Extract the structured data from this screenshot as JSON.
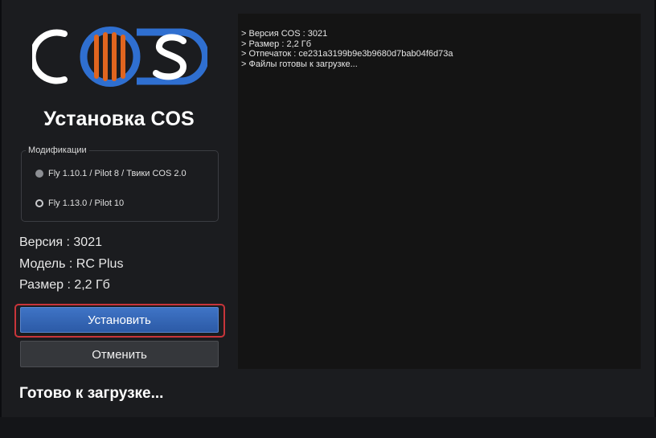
{
  "brand": {
    "logo_text": "COS",
    "colors": {
      "white": "#ffffff",
      "blue": "#2f6fd0",
      "orange": "#e0651f"
    }
  },
  "app_title": "Установка COS",
  "modifications": {
    "legend": "Модификации",
    "options": [
      {
        "label": "Fly 1.10.1 / Pilot 8 / Твики COS 2.0",
        "selected": false
      },
      {
        "label": "Fly 1.13.0 / Pilot 10",
        "selected": true
      }
    ]
  },
  "info": {
    "version": "Версия : 3021",
    "model": "Модель : RC Plus",
    "size": "Размер : 2,2 Гб"
  },
  "buttons": {
    "install": "Установить",
    "cancel": "Отменить"
  },
  "status": "Готово к загрузке...",
  "log": {
    "lines": [
      "> Версия COS : 3021",
      "> Размер : 2,2 Гб",
      "> Отпечаток : ce231a3199b9e3b9680d7bab04f6d73a",
      "> Файлы готовы к загрузке..."
    ]
  }
}
